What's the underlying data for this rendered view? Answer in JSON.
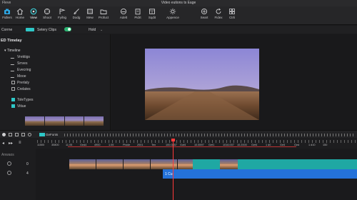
{
  "window": {
    "app_name": "Fleve",
    "title": "Video eutions ts Eage"
  },
  "toolbar": {
    "left": [
      {
        "label": "Fidlers",
        "icon": "camera-icon"
      },
      {
        "label": "Home",
        "icon": "home-icon"
      },
      {
        "label": "View",
        "icon": "view-icon",
        "active": true
      },
      {
        "label": "Shoot",
        "icon": "shoot-icon"
      },
      {
        "label": "Fyihig",
        "icon": "flag-icon"
      },
      {
        "label": "Dodg",
        "icon": "brush-icon"
      },
      {
        "label": "Mew",
        "icon": "film-icon"
      },
      {
        "label": "Profuct",
        "icon": "folder-icon"
      }
    ],
    "middle": [
      {
        "label": "Adelt",
        "icon": "gauge-icon"
      },
      {
        "label": "Pidrt",
        "icon": "clipboard-icon"
      },
      {
        "label": "Sqdit",
        "icon": "layout-icon"
      },
      {
        "label": "Appence",
        "icon": "sun-icon"
      }
    ],
    "right": [
      {
        "label": "Seart",
        "icon": "target-icon"
      },
      {
        "label": "Fidex",
        "icon": "refresh-icon"
      },
      {
        "label": "Ctrli",
        "icon": "grid-icon"
      }
    ]
  },
  "controls": {
    "label1": "Corrne",
    "label2": "Setery Clips",
    "hold": "Hold",
    "chevron": "⌄"
  },
  "panel": {
    "title": "ED Timelay",
    "parent": "Timeline",
    "items": [
      "Vrektigs",
      "Srrves",
      "Evecring",
      "Mooe",
      "Prerlaly",
      "Crelates"
    ],
    "extra": [
      "ToleTypes",
      "Vitiue"
    ]
  },
  "timeline_header": {
    "generic_label": "GeFonts"
  },
  "ruler": {
    "timecodes": [
      "11500",
      "30800",
      "11.05",
      "Ged4",
      "4900",
      "1.05",
      "Pivide",
      "2001",
      "Ten",
      "100.0857",
      "Gof4",
      "10.5597",
      "Gef1",
      "1016.007",
      "10.2000",
      "Gef4",
      "1 d0",
      "Ge5",
      "Ged",
      "1 d10",
      "150"
    ]
  },
  "tracks": {
    "anchor_label": "Anwaos",
    "track_numbers": [
      "0",
      "4"
    ],
    "blue_clip_label": "1 Cu"
  }
}
